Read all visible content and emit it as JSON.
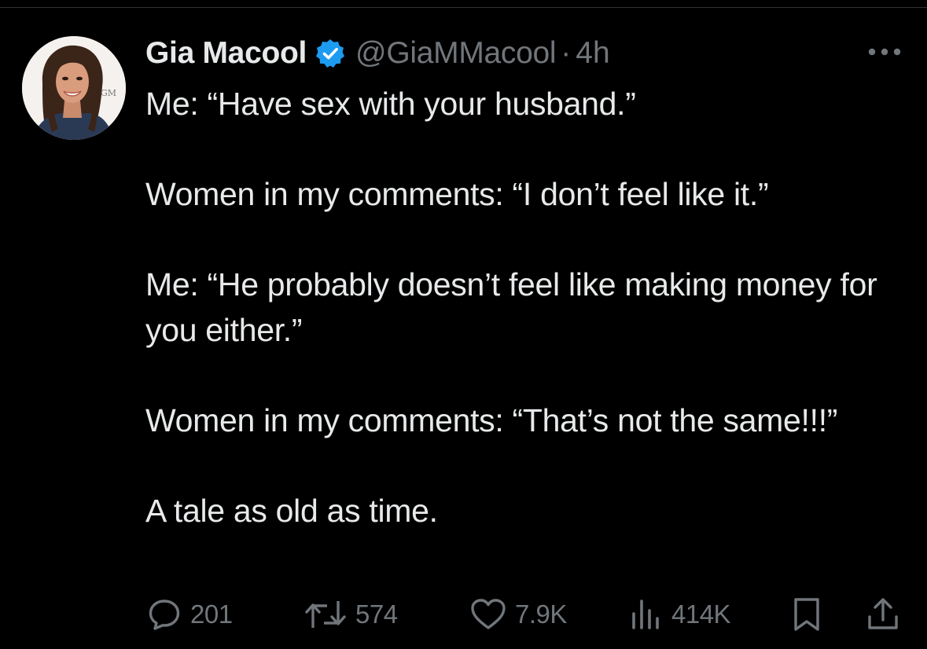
{
  "tweet": {
    "author": {
      "display_name": "Gia Macool",
      "handle": "@GiaMMacool",
      "verified": true,
      "avatar_watermark": "GM"
    },
    "separator": "·",
    "time": "4h",
    "text": "Me: “Have sex with your husband.”\n\nWomen in my comments: “I don’t feel like it.”\n\nMe: “He probably doesn’t feel like making money for you either.”\n\nWomen in my comments: “That’s not the same!!!”\n\nA tale as old as time.",
    "metrics": {
      "replies": "201",
      "retweets": "574",
      "likes": "7.9K",
      "views": "414K"
    }
  },
  "colors": {
    "background": "#000000",
    "primary_text": "#e7e9ea",
    "secondary_text": "#71767b",
    "verified_badge": "#1d9bf0",
    "divider": "#2f3336"
  },
  "icons": {
    "verified": "verified-badge-icon",
    "more": "more-options-icon",
    "reply": "reply-icon",
    "retweet": "retweet-icon",
    "like": "heart-icon",
    "views": "views-chart-icon",
    "bookmark": "bookmark-icon",
    "share": "share-icon"
  }
}
